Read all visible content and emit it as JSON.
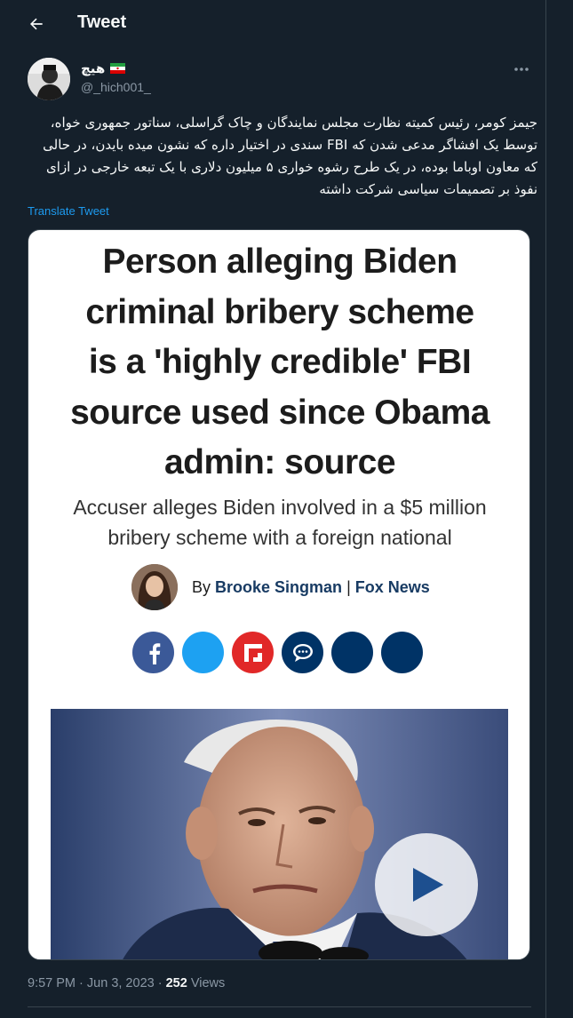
{
  "header": {
    "title": "Tweet"
  },
  "author": {
    "display_name": "هیچ",
    "handle": "@_hich001_"
  },
  "tweet": {
    "text": "جیمز کومر، رئیس کمیته نظارت مجلس نمایندگان و چاک گراسلی، سناتور جمهوری خواه، توسط یک افشاگر مدعی شدن که FBI سندی در اختیار داره که نشون میده بایدن، در حالی که معاون اوباما بوده، در یک طرح رشوه خواری ۵ میلیون دلاری با یک تبعه خارجی در ازای نفوذ بر تصمیمات سیاسی شرکت داشته",
    "translate_label": "Translate Tweet"
  },
  "media": {
    "headline_lines": [
      "Person alleging Biden",
      "criminal bribery scheme",
      "is a 'highly credible' FBI",
      "source used since Obama",
      "admin: source"
    ],
    "subhead_lines": [
      "Accuser alleges Biden involved in a $5 million",
      "bribery scheme with a foreign national"
    ],
    "byline_prefix": "By",
    "byline_author": "Brooke Singman",
    "byline_separator": "|",
    "byline_outlet": "Fox News",
    "share_icons": [
      {
        "icon": "facebook-icon",
        "color": "#3b5998"
      },
      {
        "icon": "twitter-icon",
        "color": "#1da1f2"
      },
      {
        "icon": "flipboard-icon",
        "color": "#e12828"
      },
      {
        "icon": "comment-icon",
        "color": "#003366"
      },
      {
        "icon": "email-icon",
        "color": "#003366"
      },
      {
        "icon": "print-icon",
        "color": "#003366"
      }
    ]
  },
  "meta": {
    "time": "9:57 PM",
    "sep1": "·",
    "date": "Jun 3, 2023",
    "sep2": "·",
    "views_count": "252",
    "views_label": "Views"
  },
  "colors": {
    "background": "#15202b",
    "accent": "#1d9bf0",
    "muted": "#8b98a5"
  }
}
